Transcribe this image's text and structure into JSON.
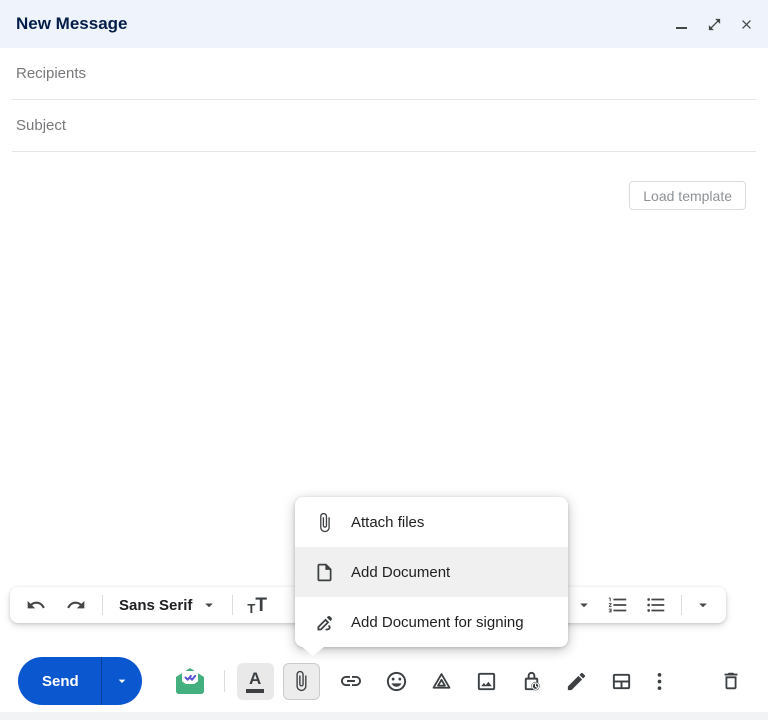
{
  "window_title": "New Message",
  "fields": {
    "recipients": {
      "placeholder": "Recipients",
      "value": ""
    },
    "subject": {
      "placeholder": "Subject",
      "value": ""
    }
  },
  "body_area": {
    "load_template_label": "Load template",
    "text": ""
  },
  "attach_menu": {
    "items": [
      {
        "label": "Attach files",
        "icon": "paperclip-icon"
      },
      {
        "label": "Add Document",
        "icon": "document-icon"
      },
      {
        "label": "Add Document for signing",
        "icon": "signature-pen-icon"
      }
    ],
    "highlighted_item": "Add Document"
  },
  "format_toolbar": {
    "font_label": "Sans Serif",
    "size_icon_small": "T",
    "size_icon_large": "T",
    "icons": [
      "undo-icon",
      "redo-icon",
      "font-dropdown-arrow",
      "text-size-icon",
      "align-dropdown-arrow",
      "numbered-list-icon",
      "bulleted-list-icon",
      "more-formatting-dropdown-arrow"
    ]
  },
  "bottom_toolbar": {
    "send_label": "Send",
    "format_letter": "A",
    "icons": [
      "send-options-arrow",
      "mailtrack-icon",
      "formatting-options-icon",
      "attach-files-icon",
      "insert-link-icon",
      "insert-emoji-icon",
      "insert-drive-icon",
      "insert-photo-icon",
      "confidential-mode-icon",
      "signature-icon",
      "layouts-icon",
      "more-options-icon",
      "discard-draft-icon"
    ]
  },
  "colors": {
    "accent_blue": "#0b57d0",
    "header_bg": "#eef3fc",
    "title_text": "#041e49",
    "icon_gray": "#3c4043",
    "mailtrack_green": "#45b07f",
    "mailtrack_check_purple": "#5a54d6",
    "menu_highlight": "#f0f0f0"
  }
}
